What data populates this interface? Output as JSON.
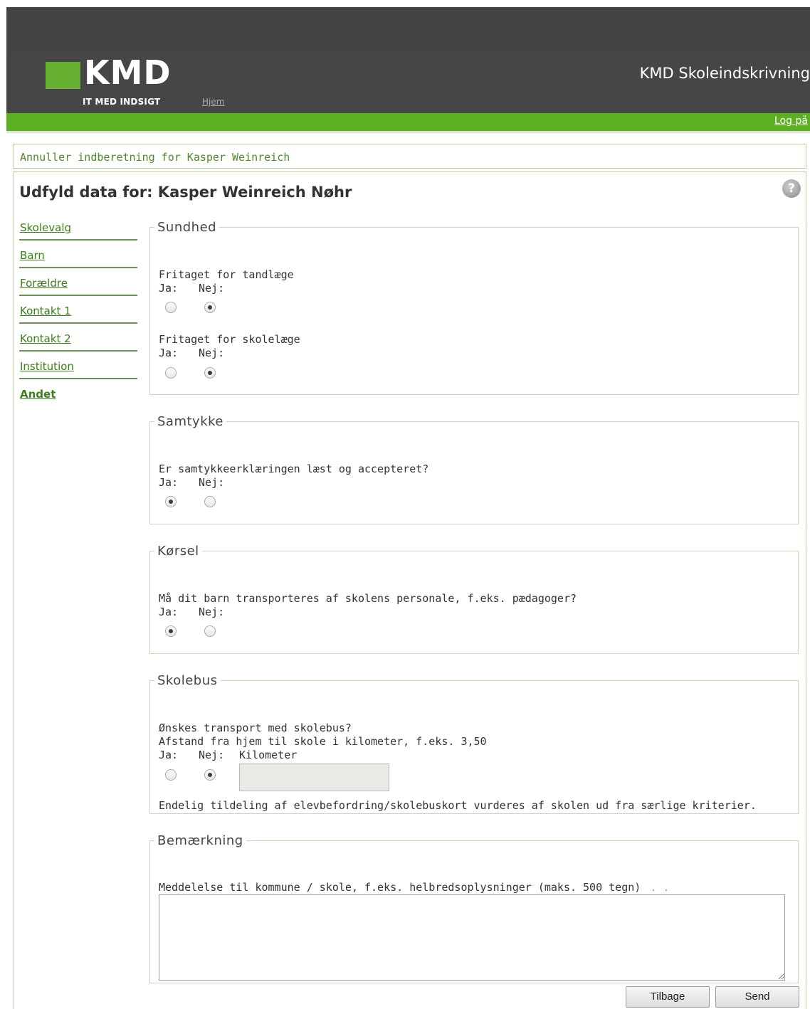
{
  "header": {
    "logo_text": "KMD",
    "tagline": "IT MED INDSIGT",
    "home_link": "Hjem",
    "app_title": "KMD Skoleindskrivning",
    "logoff_link": "Log på",
    "accent_color": "#5cae23"
  },
  "cancel_link": "Annuller indberetning for Kasper Weinreich",
  "page_title": "Udfyld data for: Kasper Weinreich Nøhr",
  "help_icon": "?",
  "nav": {
    "items": [
      {
        "label": "Skolevalg"
      },
      {
        "label": "Barn"
      },
      {
        "label": "Forældre"
      },
      {
        "label": "Kontakt 1"
      },
      {
        "label": "Kontakt 2"
      },
      {
        "label": "Institution"
      },
      {
        "label": "Andet",
        "active": true
      }
    ]
  },
  "sections": {
    "sundhed": {
      "legend": "Sundhed",
      "q1": {
        "label": "Fritaget for tandlæge",
        "yes": "Ja:",
        "no": "Nej:",
        "selected": "Nej"
      },
      "q2": {
        "label": "Fritaget for skolelæge",
        "yes": "Ja:",
        "no": "Nej:",
        "selected": "Nej"
      }
    },
    "samtykke": {
      "legend": "Samtykke",
      "q1": {
        "label": "Er samtykkeerklæringen læst og accepteret?",
        "yes": "Ja:",
        "no": "Nej:",
        "selected": "Ja"
      }
    },
    "korsel": {
      "legend": "Kørsel",
      "q1": {
        "label": "Må dit barn transporteres af skolens personale, f.eks. pædagoger?",
        "yes": "Ja:",
        "no": "Nej:",
        "selected": "Ja"
      }
    },
    "skolebus": {
      "legend": "Skolebus",
      "q1": {
        "label": "Ønskes transport med skolebus?",
        "label2": "Afstand fra hjem til skole i kilometer, f.eks. 3,50",
        "yes": "Ja:",
        "no": "Nej:",
        "km_label": "Kilometer",
        "selected": "Nej",
        "km_value": ""
      },
      "note": "Endelig tildeling af elevbefordring/skolebuskort vurderes af skolen ud fra særlige kriterier."
    },
    "bemaerkning": {
      "legend": "Bemærkning",
      "label": "Meddelelse til kommune / skole, f.eks. helbredsoplysninger (maks. 500 tegn)",
      "dots": ". .",
      "value": ""
    }
  },
  "buttons": {
    "back": "Tilbage",
    "send": "Send"
  }
}
